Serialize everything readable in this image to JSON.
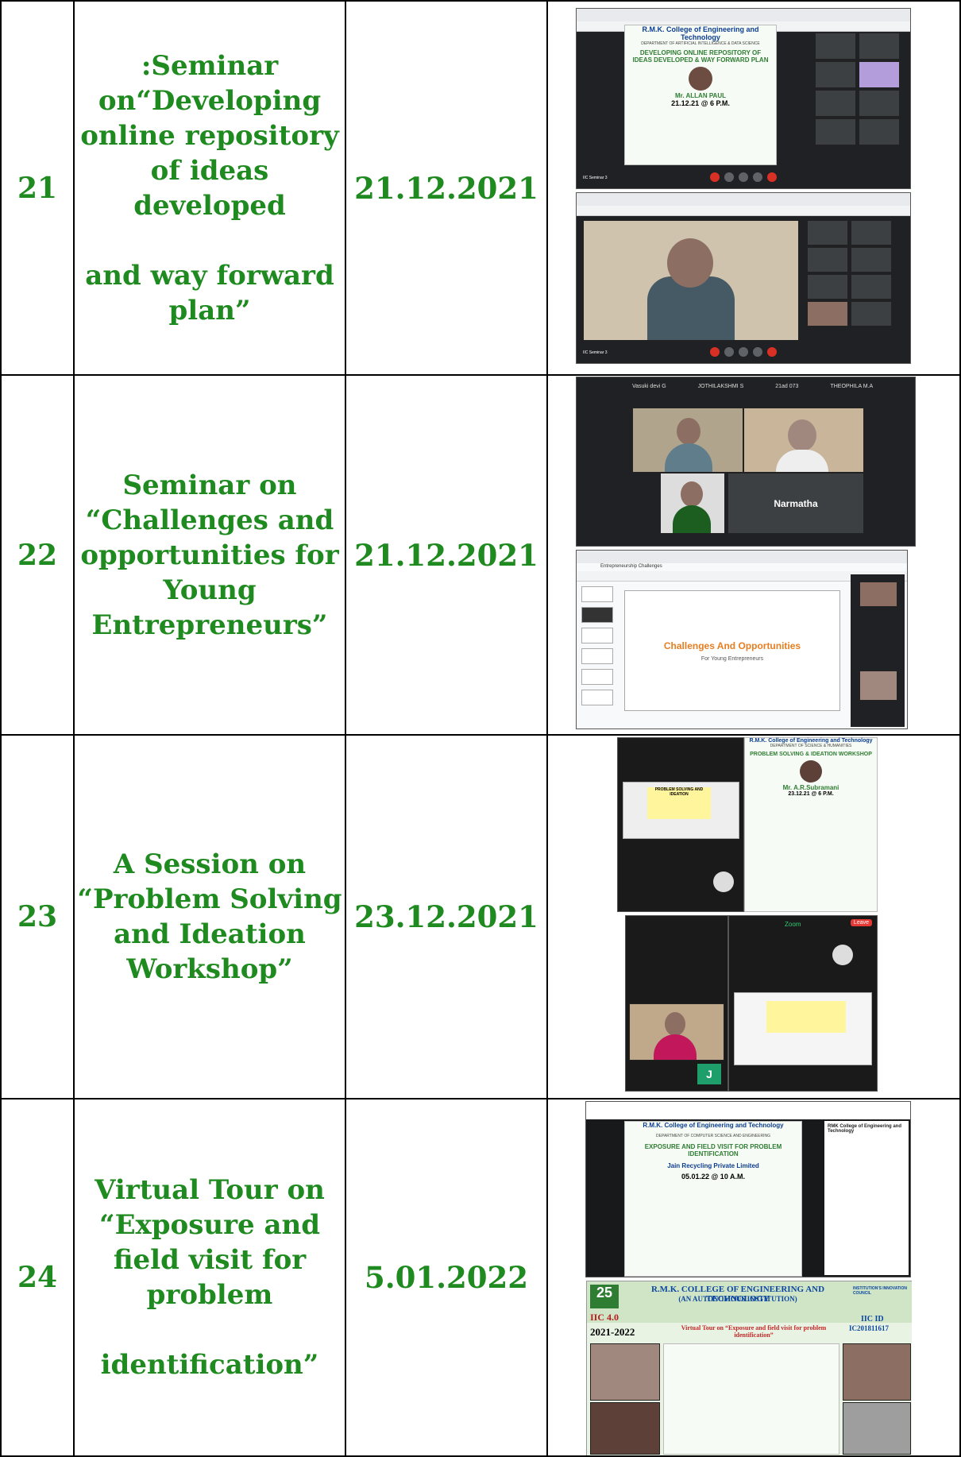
{
  "rows": [
    {
      "num": "21",
      "title_lines": [
        ":Seminar",
        "on“Developing",
        "online repository",
        "of ideas",
        "developed",
        "",
        "and way forward",
        "plan”"
      ],
      "date": "21.12.2021",
      "screens": {
        "poster_college": "R.M.K. College of Engineering and Technology",
        "poster_dept": "DEPARTMENT OF ARTIFICIAL INTELLIGENCE & DATA SCIENCE",
        "poster_topic": "DEVELOPING ONLINE REPOSITORY OF IDEAS DEVELOPED & WAY FORWARD PLAN",
        "poster_speaker": "Mr. ALLAN PAUL",
        "poster_date": "21.12.21 @ 6 P.M.",
        "meet_label_1": "IIC Seminar 3",
        "meet_label_2": "IIC Seminar 3"
      }
    },
    {
      "num": "22",
      "title_lines": [
        "Seminar on",
        "“Challenges and",
        "opportunities for",
        "Young",
        "Entrepreneurs”"
      ],
      "date": "21.12.2021",
      "screens": {
        "participant_name": "Narmatha",
        "top_names": [
          "Vasuki devi G",
          "JOTHILAKSHMI S",
          "21ad 073",
          "THEOPHILA M.A"
        ],
        "slide_title": "Challenges And Opportunities",
        "slide_sub": "For Young Entrepreneurs",
        "doc_tab": "Entrepreneurship Challenges"
      }
    },
    {
      "num": "23",
      "title_lines": [
        "A Session on",
        "“Problem Solving",
        "and Ideation",
        "Workshop”"
      ],
      "date": "23.12.2021",
      "screens": {
        "poster_college": "R.M.K. College of Engineering and Technology",
        "poster_dept": "DEPARTMENT OF SCIENCE & HUMANITIES",
        "poster_topic": "PROBLEM SOLVING & IDEATION WORKSHOP",
        "poster_speaker": "Mr. A.R.Subramani",
        "poster_date": "23.12.21 @ 6 P.M.",
        "slide_title": "PROBLEM SOLVING AND IDEATION",
        "zoom_label": "Zoom",
        "leave_label": "Leave",
        "avatar_letter": "J"
      }
    },
    {
      "num": "24",
      "title_lines": [
        "Virtual Tour on",
        "“Exposure and",
        "field visit for",
        "problem",
        "",
        "identification”"
      ],
      "date": "5.01.2022",
      "screens": {
        "poster_college": "R.M.K. College of Engineering and Technology",
        "poster_dept": "DEPARTMENT OF COMPUTER SCIENCE AND ENGINEERING",
        "poster_topic": "EXPOSURE AND FIELD VISIT FOR PROBLEM IDENTIFICATION",
        "poster_company": "Jain Recycling Private Limited",
        "poster_date": "05.01.22 @ 10 A.M.",
        "banner_college": "R.M.K. COLLEGE OF ENGINEERING AND TECHNOLOGY",
        "banner_sub": "(AN AUTONOMOUS INSTITUTION)",
        "banner_iic": "IIC 4.0",
        "banner_year": "2021-2022",
        "banner_topic": "Virtual Tour on “Exposure and field visit for problem identification”",
        "banner_iic_id_label": "IIC ID",
        "banner_iic_id": "IC201811617",
        "banner_inst": "INSTITUTION'S INNOVATION COUNCIL",
        "fb_label": "RMK College of Engineering and Technology"
      }
    }
  ]
}
